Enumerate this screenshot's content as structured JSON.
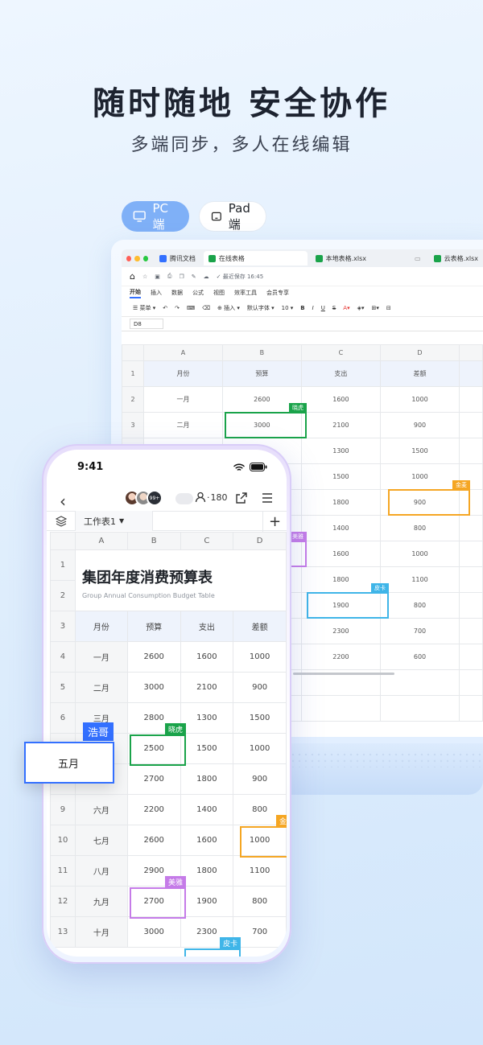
{
  "headline": "随时随地 安全协作",
  "subheadline": "多端同步，多人在线编辑",
  "device_tabs": {
    "pc": "PC端",
    "pad": "Pad端"
  },
  "colors": {
    "accent": "#3370ff",
    "green": "#1aa34a",
    "orange": "#f5a623",
    "purple": "#c57be8",
    "cyan": "#3fb5e8"
  },
  "laptop": {
    "tabs": [
      "腾讯文档",
      "在线表格",
      "本地表格.xlsx",
      "云表格.xlsx"
    ],
    "save_status": "最近保存 16:45",
    "menu": [
      "开始",
      "插入",
      "数据",
      "公式",
      "视图",
      "效率工具",
      "会员专享"
    ],
    "toolbar": {
      "menu": "菜单",
      "insert": "插入",
      "font": "默认字体",
      "size": "10"
    },
    "cell_ref": "D8",
    "col_headers": [
      "A",
      "B",
      "C",
      "D"
    ],
    "rows": [
      {
        "n": "1",
        "a": "月份",
        "b": "预算",
        "c": "支出",
        "d": "差额"
      },
      {
        "n": "2",
        "a": "一月",
        "b": "2600",
        "c": "1600",
        "d": "1000"
      },
      {
        "n": "3",
        "a": "二月",
        "b": "3000",
        "c": "2100",
        "d": "900"
      },
      {
        "n": "",
        "a": "",
        "b": "0",
        "c": "1300",
        "d": "1500"
      },
      {
        "n": "",
        "a": "",
        "b": "",
        "c": "1500",
        "d": "1000"
      },
      {
        "n": "",
        "a": "",
        "b": "",
        "c": "1800",
        "d": "900"
      },
      {
        "n": "",
        "a": "",
        "b": "",
        "c": "1400",
        "d": "800"
      },
      {
        "n": "",
        "a": "",
        "b": "",
        "c": "1600",
        "d": "1000"
      },
      {
        "n": "",
        "a": "",
        "b": "",
        "c": "1800",
        "d": "1100"
      },
      {
        "n": "",
        "a": "",
        "b": "",
        "c": "1900",
        "d": "800"
      },
      {
        "n": "",
        "a": "",
        "b": "",
        "c": "2300",
        "d": "700"
      },
      {
        "n": "",
        "a": "",
        "b": "",
        "c": "2200",
        "d": "600"
      },
      {
        "n": "",
        "a": "",
        "b": "",
        "c": "",
        "d": ""
      },
      {
        "n": "",
        "a": "",
        "b": "",
        "c": "",
        "d": ""
      }
    ],
    "collaborators": {
      "xiaohu": "晓虎",
      "jinmai": "金麦",
      "meiya": "美雅",
      "pika": "皮卡"
    }
  },
  "phone": {
    "time": "9:41",
    "avatar_more": "99+",
    "people_count": "180",
    "sheet_tab": "工作表1",
    "col_headers": [
      "A",
      "B",
      "C",
      "D"
    ],
    "title": "集团年度消费预算表",
    "subtitle": "Group Annual Consumption Budget Table",
    "header_row": {
      "n": "3",
      "a": "月份",
      "b": "预算",
      "c": "支出",
      "d": "差额"
    },
    "rows": [
      {
        "n": "4",
        "a": "一月",
        "b": "2600",
        "c": "1600",
        "d": "1000"
      },
      {
        "n": "5",
        "a": "二月",
        "b": "3000",
        "c": "2100",
        "d": "900"
      },
      {
        "n": "6",
        "a": "三月",
        "b": "2800",
        "c": "1300",
        "d": "1500"
      },
      {
        "n": "",
        "a": "",
        "b": "2500",
        "c": "1500",
        "d": "1000"
      },
      {
        "n": "",
        "a": "",
        "b": "2700",
        "c": "1800",
        "d": "900"
      },
      {
        "n": "9",
        "a": "六月",
        "b": "2200",
        "c": "1400",
        "d": "800"
      },
      {
        "n": "10",
        "a": "七月",
        "b": "2600",
        "c": "1600",
        "d": "1000"
      },
      {
        "n": "11",
        "a": "八月",
        "b": "2900",
        "c": "1800",
        "d": "1100"
      },
      {
        "n": "12",
        "a": "九月",
        "b": "2700",
        "c": "1900",
        "d": "800"
      },
      {
        "n": "13",
        "a": "十月",
        "b": "3000",
        "c": "2300",
        "d": "700"
      }
    ],
    "collaborators": {
      "xiaohu": "晓虎",
      "jinmai": "金",
      "meiya": "美雅",
      "pika": "皮卡"
    },
    "editing_user": "浩哥",
    "editing_value": "五月"
  }
}
